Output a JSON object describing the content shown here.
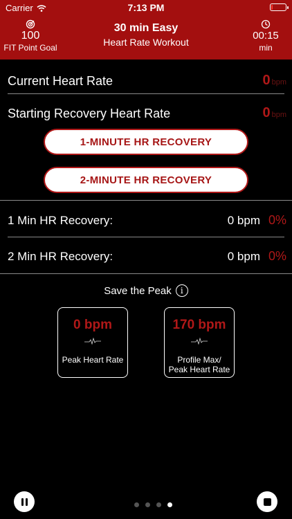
{
  "status_bar": {
    "carrier": "Carrier",
    "time": "7:13 PM",
    "battery_level": 0.1
  },
  "header": {
    "goal_value": "100",
    "goal_label": "FIT Point Goal",
    "title": "30 min Easy",
    "subtitle": "Heart Rate Workout",
    "timer_value": "00:15",
    "timer_unit": "min",
    "background_color": "#a30f0f"
  },
  "current_hr": {
    "label": "Current Heart Rate",
    "value": "0",
    "unit": "bpm"
  },
  "starting_recovery_hr": {
    "label": "Starting Recovery Heart Rate",
    "value": "0",
    "unit": "bpm"
  },
  "buttons": {
    "one_minute": "1-MINUTE HR RECOVERY",
    "two_minute": "2-MINUTE HR RECOVERY"
  },
  "recovery": [
    {
      "label": "1 Min HR Recovery:",
      "bpm": "0 bpm",
      "percent": "0%"
    },
    {
      "label": "2 Min HR Recovery:",
      "bpm": "0 bpm",
      "percent": "0%"
    }
  ],
  "peak": {
    "title": "Save the Peak",
    "cards": [
      {
        "value": "0 bpm",
        "label": "Peak Heart Rate"
      },
      {
        "value": "170 bpm",
        "label": "Profile Max/ Peak Heart Rate"
      }
    ]
  },
  "pager": {
    "count": 4,
    "active_index": 3
  },
  "icons": {
    "goal": "target-icon",
    "timer": "clock-icon",
    "info": "info-icon",
    "pause": "pause-icon",
    "stop": "stop-icon"
  },
  "colors": {
    "accent": "#b01818",
    "background": "#000000"
  }
}
